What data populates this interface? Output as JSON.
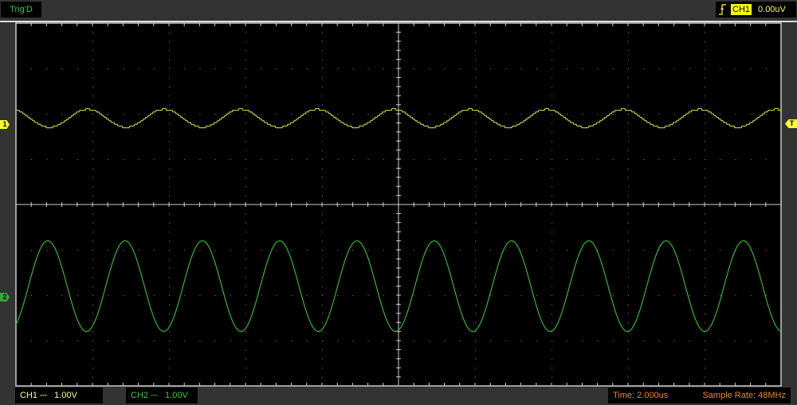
{
  "header": {
    "trig_status": "Trig'D",
    "trigger_source": "CH1",
    "trigger_level": "0.00uV",
    "trigger_edge_icon": "rising-edge-icon"
  },
  "markers": {
    "ch1": "1",
    "ch2": "2",
    "trigger": "T"
  },
  "footer": {
    "ch1_label": "CH1",
    "ch1_coupling": "⎓",
    "ch1_scale": "1.00V",
    "ch2_label": "CH2",
    "ch2_coupling": "⎓",
    "ch2_scale": "1.00V",
    "time": "Time: 2.000us",
    "sample_rate": "Sample Rate: 48MHz"
  },
  "colors": {
    "ch1": "#e8e83a",
    "ch2": "#2eb82e",
    "grid": "#888888",
    "background": "#000000"
  },
  "waveforms": {
    "ch1": {
      "cycles_on_screen": 10,
      "amplitude_div": 0.2,
      "offset_div": 1.9
    },
    "ch2": {
      "cycles_on_screen": 9.9,
      "amplitude_div": 1.0,
      "offset_div": -1.8
    }
  },
  "grid": {
    "h_divisions": 10,
    "v_divisions": 8
  }
}
